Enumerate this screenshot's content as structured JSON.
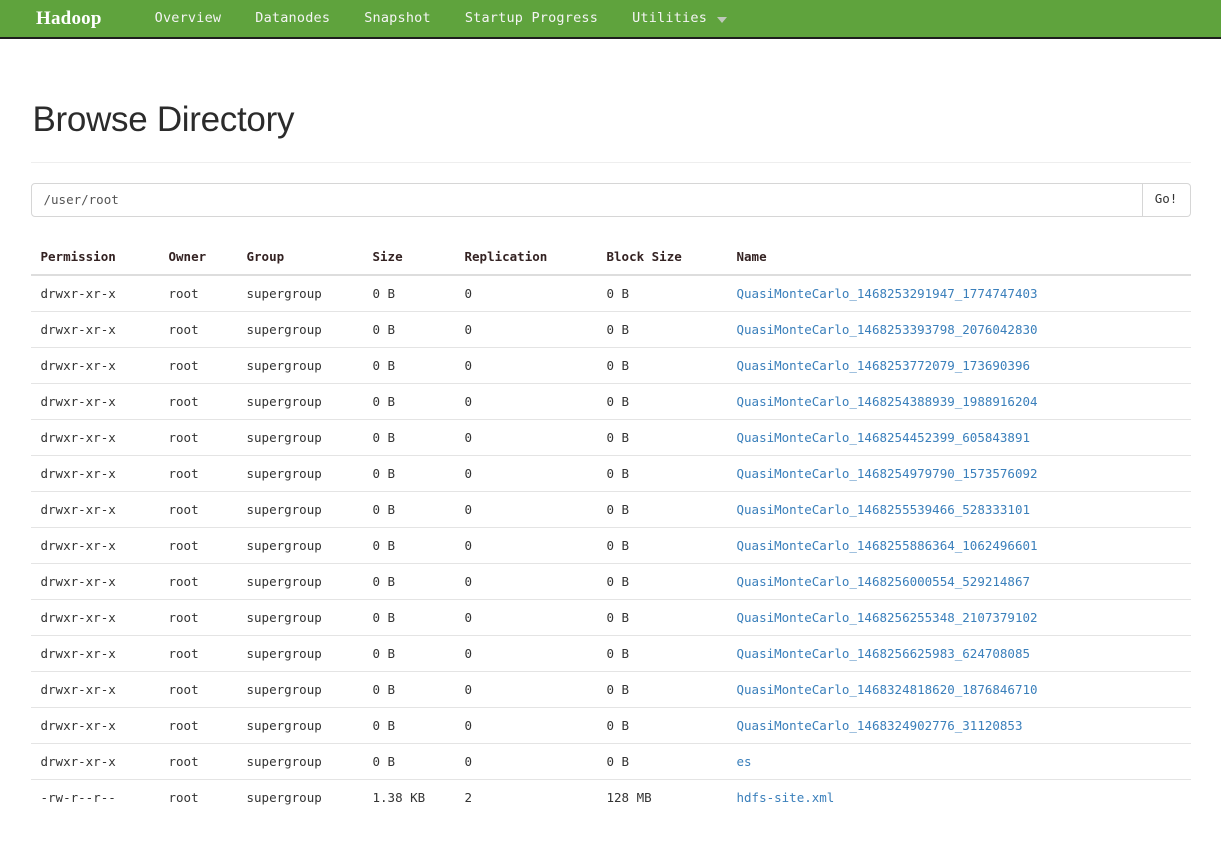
{
  "navbar": {
    "brand": "Hadoop",
    "items": [
      {
        "label": "Overview",
        "icon": "",
        "dropdown": false
      },
      {
        "label": "Datanodes",
        "icon": "",
        "dropdown": false
      },
      {
        "label": "Snapshot",
        "icon": "",
        "dropdown": false
      },
      {
        "label": "Startup Progress",
        "icon": "",
        "dropdown": false
      },
      {
        "label": "Utilities",
        "icon": "caret-down-icon",
        "dropdown": true
      }
    ],
    "background_color": "#5fa33d"
  },
  "page": {
    "title": "Browse Directory"
  },
  "path_bar": {
    "value": "/user/root",
    "placeholder": "/user/root",
    "go_label": "Go!"
  },
  "table": {
    "columns": [
      "Permission",
      "Owner",
      "Group",
      "Size",
      "Replication",
      "Block Size",
      "Name"
    ],
    "rows": [
      {
        "permission": "drwxr-xr-x",
        "owner": "root",
        "group": "supergroup",
        "size": "0 B",
        "replication": "0",
        "block_size": "0 B",
        "name": "QuasiMonteCarlo_1468253291947_1774747403"
      },
      {
        "permission": "drwxr-xr-x",
        "owner": "root",
        "group": "supergroup",
        "size": "0 B",
        "replication": "0",
        "block_size": "0 B",
        "name": "QuasiMonteCarlo_1468253393798_2076042830"
      },
      {
        "permission": "drwxr-xr-x",
        "owner": "root",
        "group": "supergroup",
        "size": "0 B",
        "replication": "0",
        "block_size": "0 B",
        "name": "QuasiMonteCarlo_1468253772079_173690396"
      },
      {
        "permission": "drwxr-xr-x",
        "owner": "root",
        "group": "supergroup",
        "size": "0 B",
        "replication": "0",
        "block_size": "0 B",
        "name": "QuasiMonteCarlo_1468254388939_1988916204"
      },
      {
        "permission": "drwxr-xr-x",
        "owner": "root",
        "group": "supergroup",
        "size": "0 B",
        "replication": "0",
        "block_size": "0 B",
        "name": "QuasiMonteCarlo_1468254452399_605843891"
      },
      {
        "permission": "drwxr-xr-x",
        "owner": "root",
        "group": "supergroup",
        "size": "0 B",
        "replication": "0",
        "block_size": "0 B",
        "name": "QuasiMonteCarlo_1468254979790_1573576092"
      },
      {
        "permission": "drwxr-xr-x",
        "owner": "root",
        "group": "supergroup",
        "size": "0 B",
        "replication": "0",
        "block_size": "0 B",
        "name": "QuasiMonteCarlo_1468255539466_528333101"
      },
      {
        "permission": "drwxr-xr-x",
        "owner": "root",
        "group": "supergroup",
        "size": "0 B",
        "replication": "0",
        "block_size": "0 B",
        "name": "QuasiMonteCarlo_1468255886364_1062496601"
      },
      {
        "permission": "drwxr-xr-x",
        "owner": "root",
        "group": "supergroup",
        "size": "0 B",
        "replication": "0",
        "block_size": "0 B",
        "name": "QuasiMonteCarlo_1468256000554_529214867"
      },
      {
        "permission": "drwxr-xr-x",
        "owner": "root",
        "group": "supergroup",
        "size": "0 B",
        "replication": "0",
        "block_size": "0 B",
        "name": "QuasiMonteCarlo_1468256255348_2107379102"
      },
      {
        "permission": "drwxr-xr-x",
        "owner": "root",
        "group": "supergroup",
        "size": "0 B",
        "replication": "0",
        "block_size": "0 B",
        "name": "QuasiMonteCarlo_1468256625983_624708085"
      },
      {
        "permission": "drwxr-xr-x",
        "owner": "root",
        "group": "supergroup",
        "size": "0 B",
        "replication": "0",
        "block_size": "0 B",
        "name": "QuasiMonteCarlo_1468324818620_1876846710"
      },
      {
        "permission": "drwxr-xr-x",
        "owner": "root",
        "group": "supergroup",
        "size": "0 B",
        "replication": "0",
        "block_size": "0 B",
        "name": "QuasiMonteCarlo_1468324902776_31120853"
      },
      {
        "permission": "drwxr-xr-x",
        "owner": "root",
        "group": "supergroup",
        "size": "0 B",
        "replication": "0",
        "block_size": "0 B",
        "name": "es"
      },
      {
        "permission": "-rw-r--r--",
        "owner": "root",
        "group": "supergroup",
        "size": "1.38 KB",
        "replication": "2",
        "block_size": "128 MB",
        "name": "hdfs-site.xml"
      }
    ]
  },
  "colors": {
    "navbar_green": "#5fa33d",
    "link_blue": "#3a7fbb",
    "heading": "#2b2b2b"
  }
}
